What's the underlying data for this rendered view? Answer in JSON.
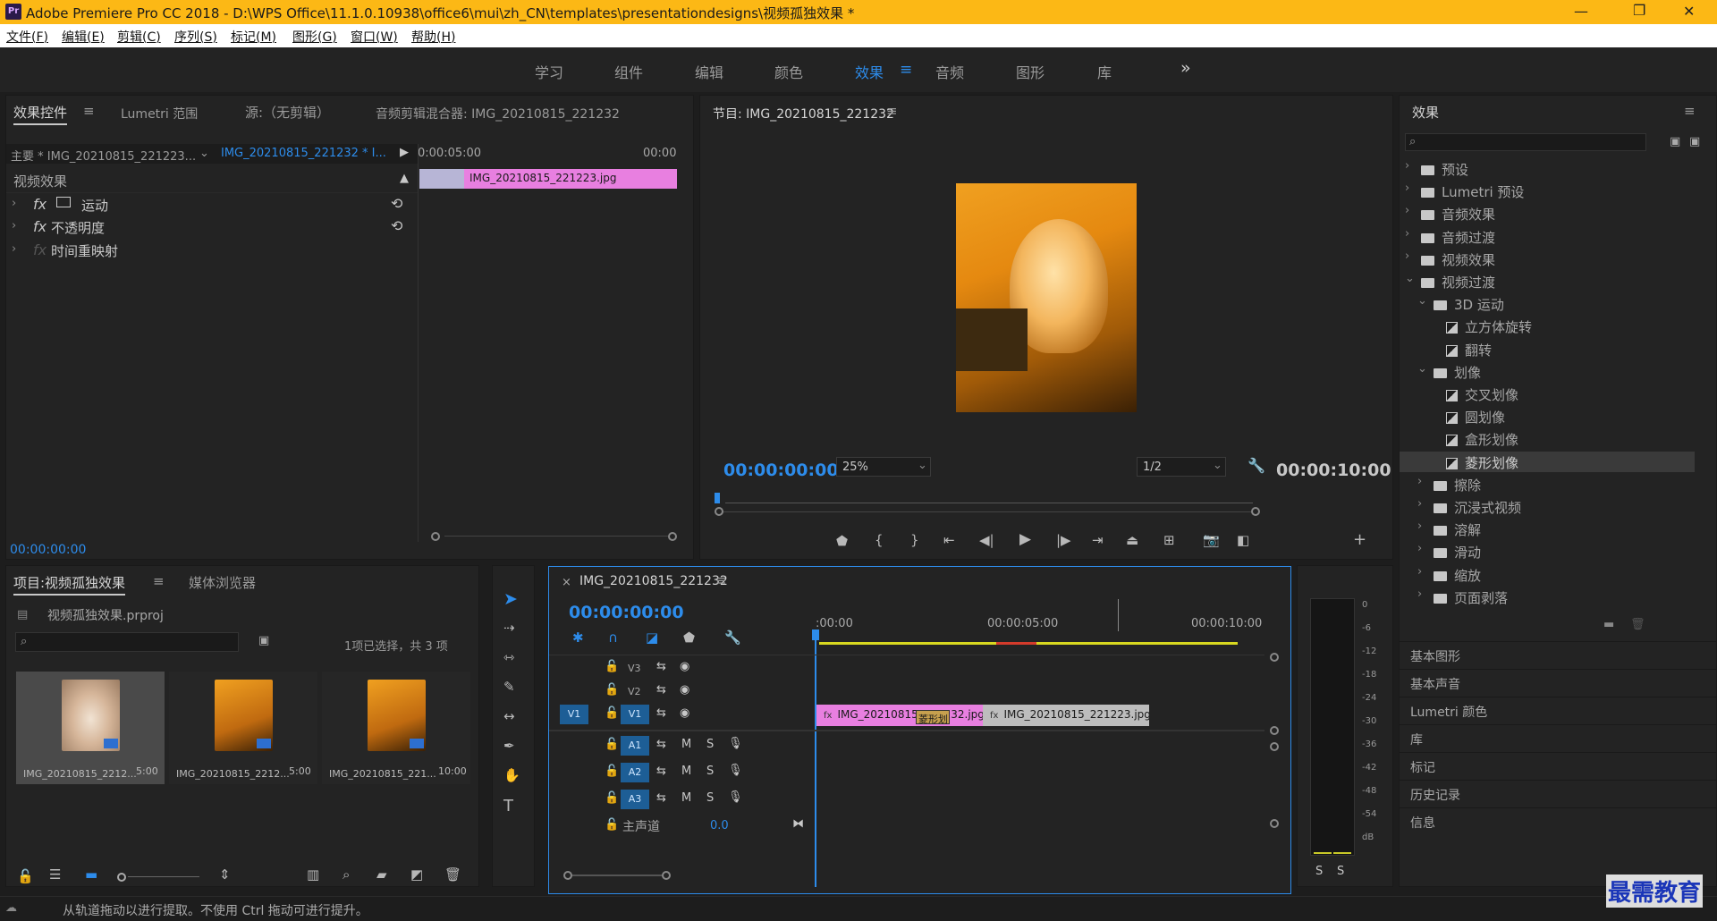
{
  "app": {
    "title": "Adobe Premiere Pro CC 2018 - D:\\WPS Office\\11.1.0.10938\\office6\\mui\\zh_CN\\templates\\presentationdesigns\\视频孤独效果 *",
    "logo": "Pr"
  },
  "menu": [
    "文件(F)",
    "编辑(E)",
    "剪辑(C)",
    "序列(S)",
    "标记(M)",
    "图形(G)",
    "窗口(W)",
    "帮助(H)"
  ],
  "workspaces": [
    "学习",
    "组件",
    "编辑",
    "颜色",
    "效果",
    "音频",
    "图形",
    "库"
  ],
  "workspace_active": "效果",
  "workspace_more": "»",
  "effect_controls": {
    "tabs": [
      "效果控件",
      "Lumetri 范围",
      "源:（无剪辑）",
      "音频剪辑混合器: IMG_20210815_221232"
    ],
    "master": "主要 * IMG_20210815_221223...",
    "sequence": "IMG_20210815_221232 * I...",
    "time_start": "0:00:05:00",
    "time_end": "00:00",
    "clip": "IMG_20210815_221223.jpg",
    "section": "视频效果",
    "effects": [
      "运动",
      "不透明度",
      "时间重映射"
    ],
    "timecode": "00:00:00:00"
  },
  "program": {
    "title": "节目: IMG_20210815_221232",
    "timecode": "00:00:00:00",
    "zoom": "25%",
    "resolution": "1/2",
    "duration": "00:00:10:00"
  },
  "effects_panel": {
    "title": "效果",
    "tree": [
      {
        "label": "预设",
        "level": 0,
        "type": "folder",
        "exp": "closed"
      },
      {
        "label": "Lumetri 预设",
        "level": 0,
        "type": "folder",
        "exp": "closed"
      },
      {
        "label": "音频效果",
        "level": 0,
        "type": "folder",
        "exp": "closed"
      },
      {
        "label": "音频过渡",
        "level": 0,
        "type": "folder",
        "exp": "closed"
      },
      {
        "label": "视频效果",
        "level": 0,
        "type": "folder",
        "exp": "closed"
      },
      {
        "label": "视频过渡",
        "level": 0,
        "type": "folder",
        "exp": "open"
      },
      {
        "label": "3D 运动",
        "level": 1,
        "type": "folder",
        "exp": "open"
      },
      {
        "label": "立方体旋转",
        "level": 2,
        "type": "fx",
        "exp": ""
      },
      {
        "label": "翻转",
        "level": 2,
        "type": "fx",
        "exp": ""
      },
      {
        "label": "划像",
        "level": 1,
        "type": "folder",
        "exp": "open"
      },
      {
        "label": "交叉划像",
        "level": 2,
        "type": "fx",
        "exp": ""
      },
      {
        "label": "圆划像",
        "level": 2,
        "type": "fx",
        "exp": ""
      },
      {
        "label": "盒形划像",
        "level": 2,
        "type": "fx",
        "exp": ""
      },
      {
        "label": "菱形划像",
        "level": 2,
        "type": "fx",
        "exp": "",
        "selected": true
      },
      {
        "label": "擦除",
        "level": 1,
        "type": "folder",
        "exp": "closed"
      },
      {
        "label": "沉浸式视频",
        "level": 1,
        "type": "folder",
        "exp": "closed"
      },
      {
        "label": "溶解",
        "level": 1,
        "type": "folder",
        "exp": "closed"
      },
      {
        "label": "滑动",
        "level": 1,
        "type": "folder",
        "exp": "closed"
      },
      {
        "label": "缩放",
        "level": 1,
        "type": "folder",
        "exp": "closed"
      },
      {
        "label": "页面剥落",
        "level": 1,
        "type": "folder",
        "exp": "closed"
      }
    ],
    "sections": [
      "基本图形",
      "基本声音",
      "Lumetri 颜色",
      "库",
      "标记",
      "历史记录",
      "信息"
    ]
  },
  "project": {
    "tabs": [
      "项目:视频孤独效果",
      "媒体浏览器"
    ],
    "file": "视频孤独效果.prproj",
    "selection": "1项已选择，共 3 项",
    "items": [
      {
        "name": "IMG_20210815_2212...",
        "dur": "5:00"
      },
      {
        "name": "IMG_20210815_2212...",
        "dur": "5:00"
      },
      {
        "name": "IMG_20210815_221...",
        "dur": "10:00"
      }
    ]
  },
  "timeline": {
    "title": "IMG_20210815_221232",
    "timecode": "00:00:00:00",
    "ruler": [
      ":00:00",
      "00:00:05:00",
      "00:00:10:00"
    ],
    "video_tracks": [
      "V3",
      "V2",
      "V1"
    ],
    "audio_tracks": [
      "A1",
      "A2",
      "A3"
    ],
    "source_patch": "V1",
    "master": "主声道",
    "master_value": "0.0",
    "clip1": "IMG_20210815_221232.jpg",
    "clip2": "IMG_20210815_221223.jpg",
    "transition": "菱形划",
    "fx": "fx"
  },
  "meter": {
    "ticks": [
      "0",
      "-6",
      "-12",
      "-18",
      "-24",
      "-30",
      "-36",
      "-42",
      "-48",
      "-54",
      "dB"
    ],
    "solo": [
      "S",
      "S"
    ]
  },
  "status": "从轨道拖动以进行提取。不使用 Ctrl 拖动可进行提升。",
  "watermark": "最需教育",
  "colors": {
    "accent": "#2d8ceb",
    "title_bar": "#fcb815",
    "clip_pink": "#e87fe0",
    "clip_gray": "#bdbdbd"
  }
}
